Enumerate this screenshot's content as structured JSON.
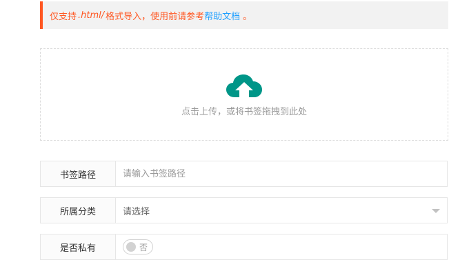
{
  "notice": {
    "prefix": "仅支持",
    "format": ".html/",
    "middle": "格式导入，使用前请参考",
    "link": "帮助文档",
    "suffix": "。"
  },
  "upload": {
    "hint": "点击上传，或将书签拖拽到此处",
    "icon": "cloud-upload-icon",
    "icon_color": "#009688"
  },
  "form": {
    "path": {
      "label": "书签路径",
      "placeholder": "请输入书签路径",
      "value": ""
    },
    "category": {
      "label": "所属分类",
      "value": "请选择"
    },
    "private": {
      "label": "是否私有",
      "switch_text": "否",
      "on": false
    }
  },
  "colors": {
    "accent": "#ff5722",
    "link": "#1e9fff",
    "brand": "#009688"
  }
}
